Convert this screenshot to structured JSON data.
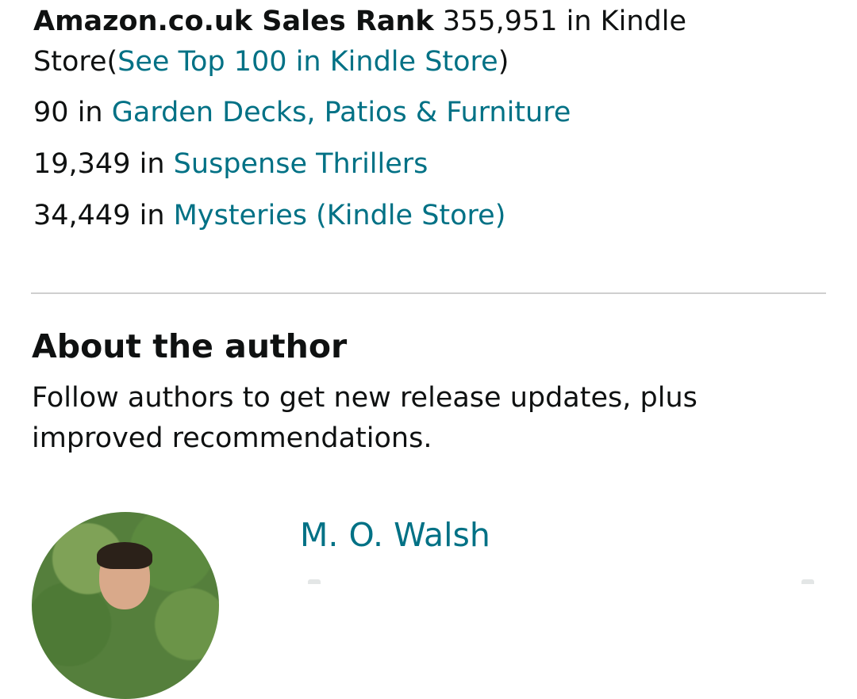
{
  "sales_rank": {
    "label": "Amazon.co.uk Sales Rank",
    "value": "355,951",
    "in_text": "in Kindle Store",
    "open_paren": "(",
    "link": "See Top 100 in Kindle Store",
    "close_paren": ")"
  },
  "category_ranks": [
    {
      "rank": "90",
      "in": "in",
      "category": "Garden Decks, Patios & Furniture"
    },
    {
      "rank": "19,349",
      "in": "in",
      "category": "Suspense Thrillers"
    },
    {
      "rank": "34,449",
      "in": "in",
      "category": "Mysteries (Kindle Store)"
    }
  ],
  "about_author": {
    "heading": "About the author",
    "description": "Follow authors to get new release updates, plus improved recommendations.",
    "author_name": "M. O. Walsh"
  },
  "colors": {
    "link": "#007185",
    "text": "#0f1111",
    "divider": "#cfcfcf"
  }
}
